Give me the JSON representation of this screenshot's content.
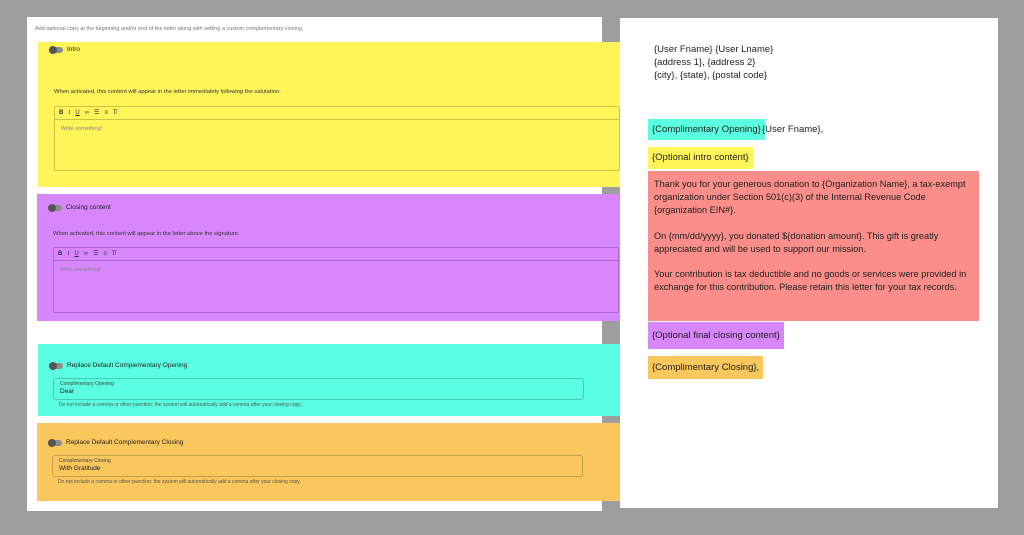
{
  "form": {
    "helper_text": "Add optional copy at the beginning and/or end of the letter along with setting a custom complementary closing.",
    "intro": {
      "label": "Intro",
      "description": "When activated, this content will appear in the letter immediately following the salutation.",
      "placeholder": "Write something!"
    },
    "closing": {
      "label": "Closing content",
      "description": "When activated, this content will appear in the letter above the signature.",
      "placeholder": "Write something!"
    },
    "opening_replace": {
      "label": "Replace Default Complementary Opening",
      "field_label": "Complimentary Opening",
      "field_value": "Dear",
      "help": "Do not include a comma or other punction; the system will automatically add a comma after your closing copy."
    },
    "closing_replace": {
      "label": "Replace Default Complementary Closing",
      "field_label": "Complimentary Closing",
      "field_value": "With Gratitude",
      "help": "Do not include a comma or other punction; the system will automatically add a comma after your closing copy."
    },
    "toolbar": {
      "bold": "B",
      "italic": "I",
      "underline": "U",
      "link": "∞",
      "ordered_list": "☰",
      "bullet_list": "≡",
      "clear_format": "T̸"
    }
  },
  "letter": {
    "address_line1": "{User Fname} {User Lname}",
    "address_line2": "{address 1}, {address 2}",
    "address_line3": "{city}, {state}, {postal code}",
    "opening": "{Complimentary Opening}",
    "salutation_name": "{User Fname},",
    "intro": "{Optional intro content}",
    "body_p1": "Thank you for your generous donation to {Organization Name}, a tax-exempt organization under Section 501(c)(3) of the Internal Revenue Code {organization EIN#}.",
    "body_p2": "On {mm/dd/yyyy}, you donated ${donation amount}. This gift is greatly appreciated and will be used to support our mission.",
    "body_p3": "Your contribution is tax deductible and no goods or services were provided in exchange for this contribution. Please retain this letter for your tax records.",
    "final_closing": "{Optional final closing content}",
    "closing": "{Complimentary Closing},"
  },
  "colors": {
    "intro": "#fff559",
    "closing": "#d787fb",
    "opening": "#59ffe0",
    "complimentary_closing": "#fac75d",
    "body": "#fb8e8a"
  }
}
